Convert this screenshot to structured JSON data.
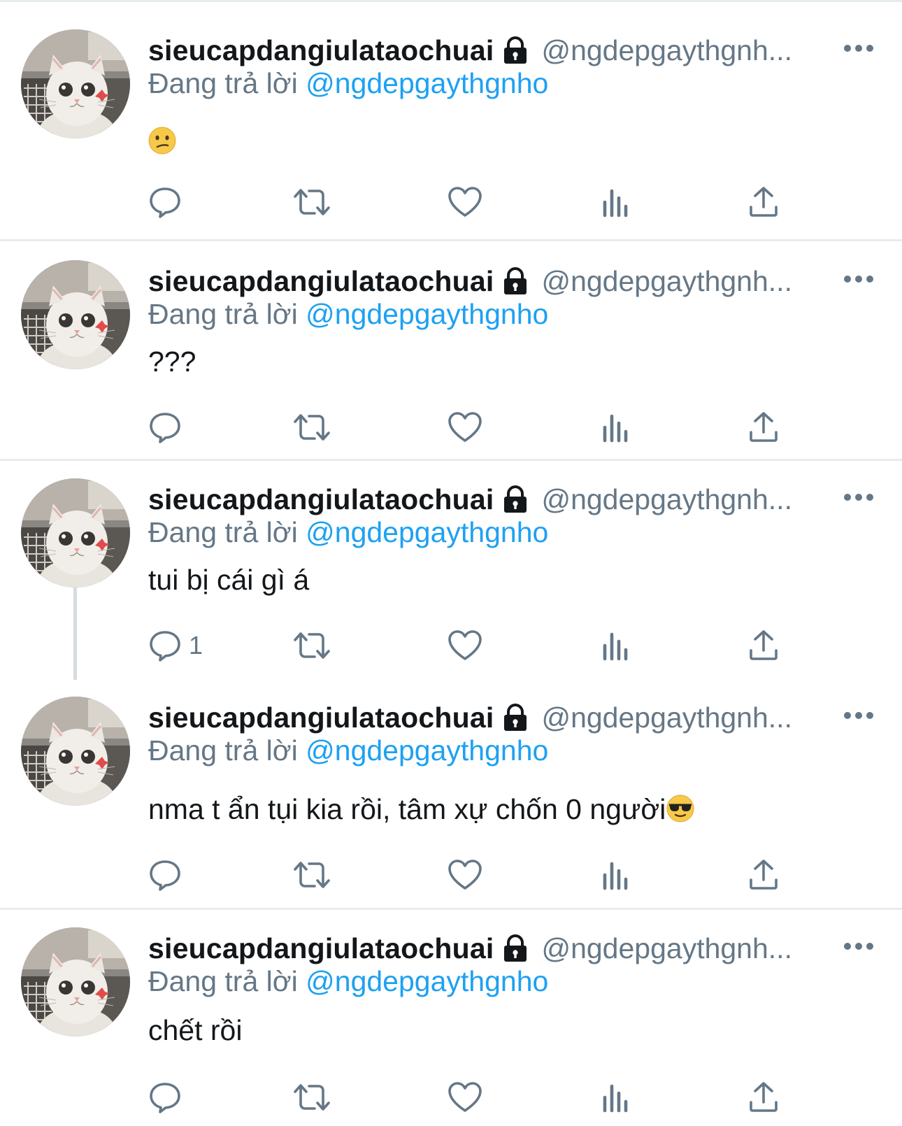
{
  "tweets": [
    {
      "display_name": "sieucapdangiulataochuai",
      "handle": "@ngdepgaythgnh...",
      "reply_prefix": "Đang trả lời",
      "reply_to": "@ngdepgaythgnho",
      "text": "",
      "emoji": "confused-face",
      "reply_count": ""
    },
    {
      "display_name": "sieucapdangiulataochuai",
      "handle": "@ngdepgaythgnh...",
      "reply_prefix": "Đang trả lời",
      "reply_to": "@ngdepgaythgnho",
      "text": "???",
      "reply_count": ""
    },
    {
      "display_name": "sieucapdangiulataochuai",
      "handle": "@ngdepgaythgnh...",
      "reply_prefix": "Đang trả lời",
      "reply_to": "@ngdepgaythgnho",
      "text": "tui bị cái gì á",
      "reply_count": "1"
    },
    {
      "display_name": "sieucapdangiulataochuai",
      "handle": "@ngdepgaythgnh...",
      "reply_prefix": "Đang trả lời",
      "reply_to": "@ngdepgaythgnho",
      "text": "nma t ẩn tụi kia rồi, tâm xự chốn 0 người",
      "emoji": "sunglasses-face",
      "reply_count": ""
    },
    {
      "display_name": "sieucapdangiulataochuai",
      "handle": "@ngdepgaythgnh...",
      "reply_prefix": "Đang trả lời",
      "reply_to": "@ngdepgaythgnho",
      "text": "chết rồi",
      "reply_count": ""
    }
  ],
  "colors": {
    "text": "#14171a",
    "secondary": "#657786",
    "mention": "#1da1f2",
    "separator": "#e6ecf0",
    "thread_line": "#d6dbdf",
    "icon": "#657786"
  },
  "icons": [
    "lock-icon",
    "more-icon",
    "reply-icon",
    "retweet-icon",
    "like-icon",
    "analytics-icon",
    "share-icon"
  ]
}
